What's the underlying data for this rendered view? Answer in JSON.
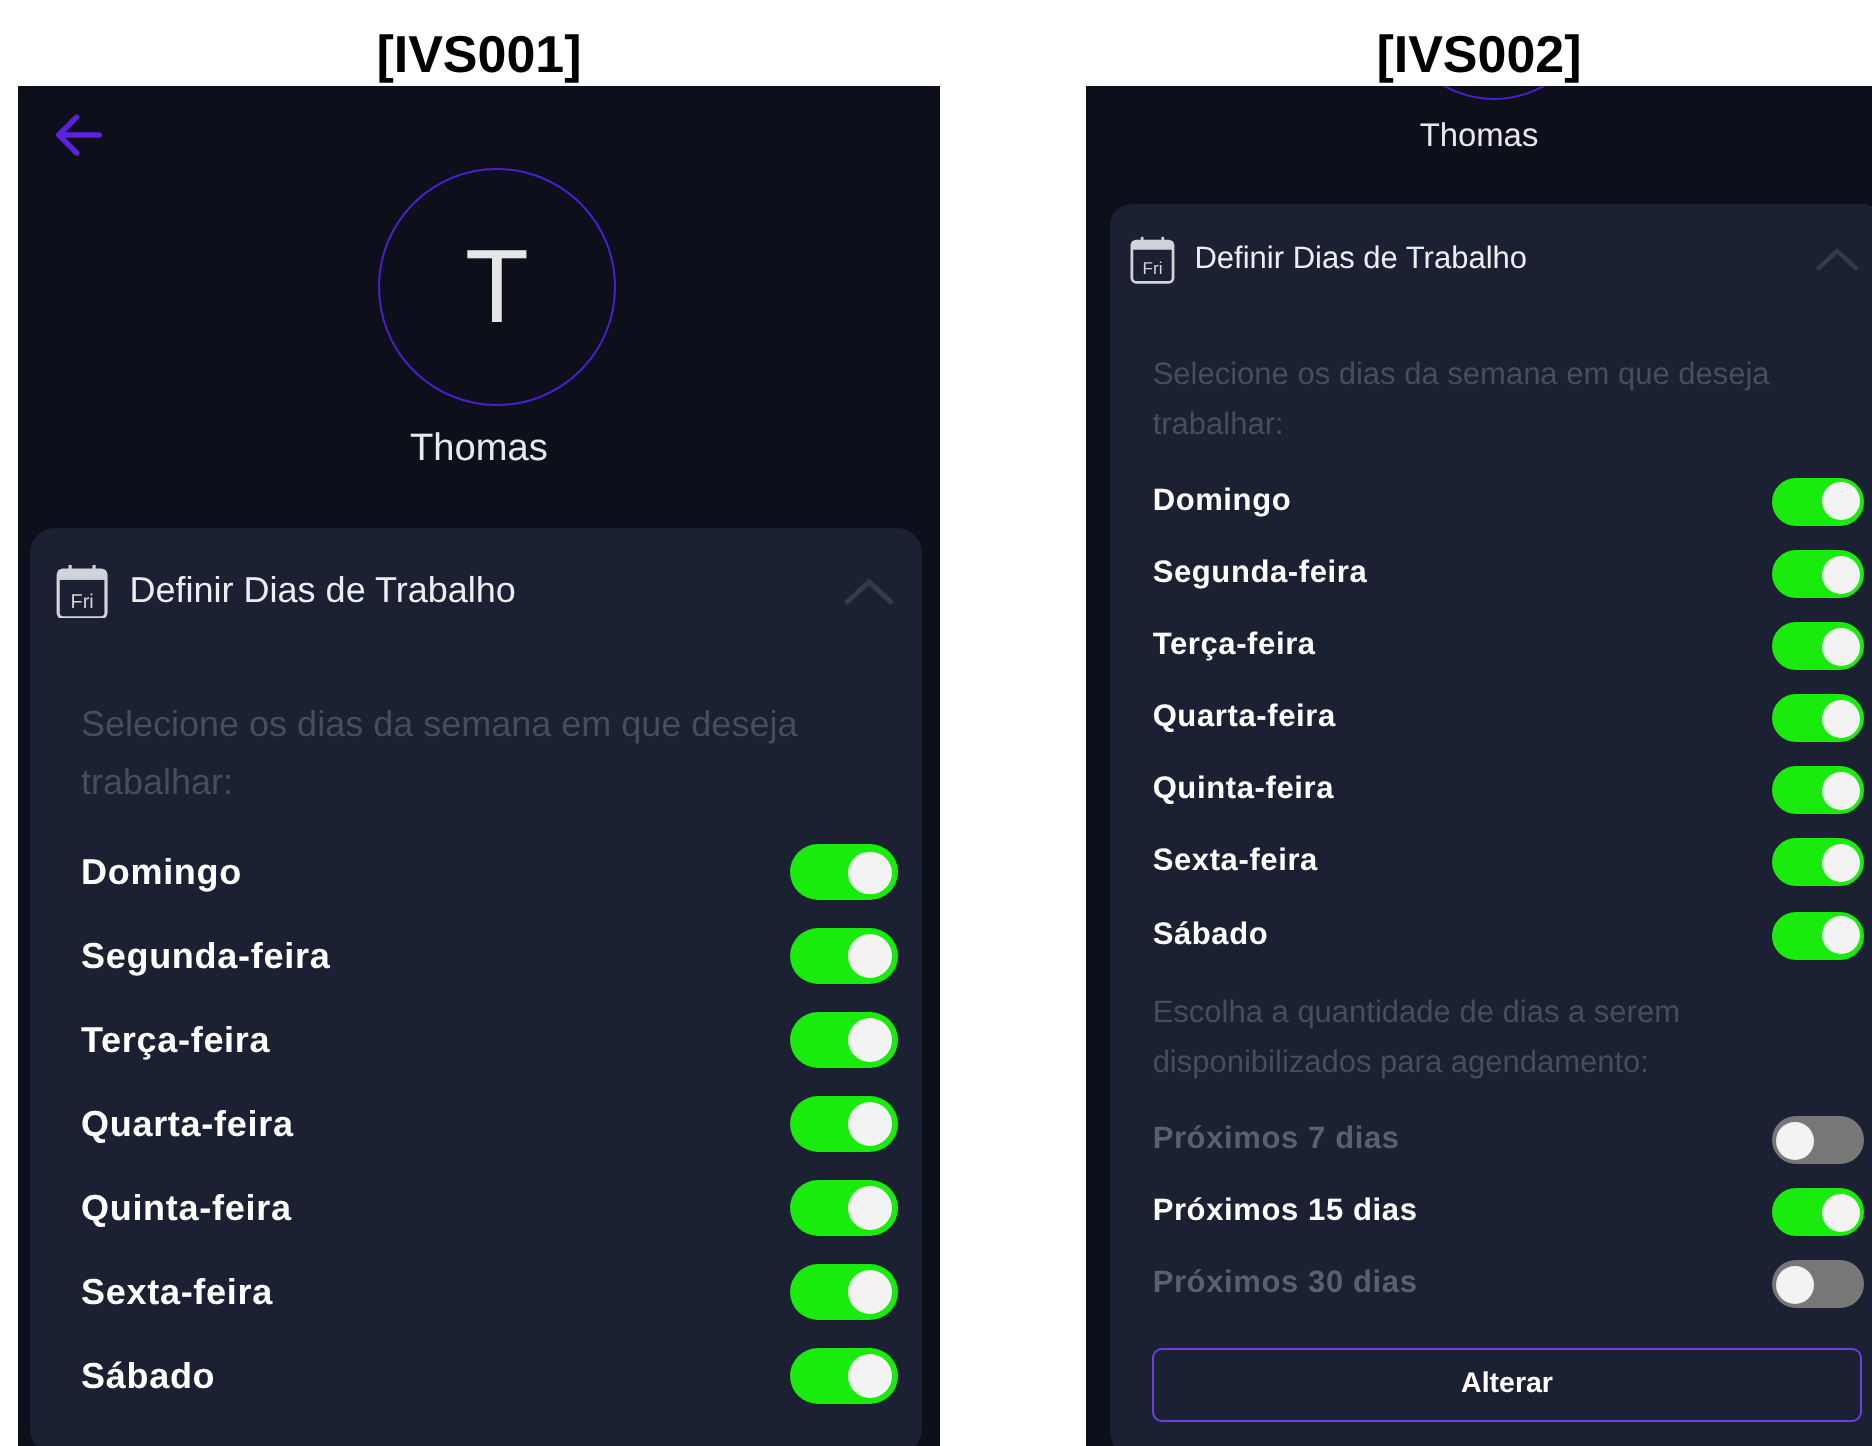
{
  "screens": [
    {
      "label": "[IVS001]",
      "kind": "top",
      "back_button": true,
      "avatar": {
        "initial": "T"
      },
      "name": "Thomas",
      "card": {
        "title": "Definir Dias de Trabalho",
        "icon_label": "Fri",
        "expanded": true,
        "sections": [
          {
            "description": "Selecione os dias da semana em que deseja trabalhar:",
            "options": [
              {
                "label": "Domingo",
                "on": true
              },
              {
                "label": "Segunda-feira",
                "on": true
              },
              {
                "label": "Terça-feira",
                "on": true
              },
              {
                "label": "Quarta-feira",
                "on": true
              },
              {
                "label": "Quinta-feira",
                "on": true
              },
              {
                "label": "Sexta-feira",
                "on": true
              },
              {
                "label": "Sábado",
                "on": true
              }
            ]
          }
        ]
      }
    },
    {
      "label": "[IVS002]",
      "kind": "scrolled",
      "name": "Thomas",
      "card": {
        "title": "Definir Dias de Trabalho",
        "icon_label": "Fri",
        "expanded": true,
        "sections": [
          {
            "description": "Selecione os dias da semana em que deseja trabalhar:",
            "options": [
              {
                "label": "Domingo",
                "on": true
              },
              {
                "label": "Segunda-feira",
                "on": true
              },
              {
                "label": "Terça-feira",
                "on": true
              },
              {
                "label": "Quarta-feira",
                "on": true
              },
              {
                "label": "Quinta-feira",
                "on": true
              },
              {
                "label": "Sexta-feira",
                "on": true
              },
              {
                "label": "Sábado",
                "on": true
              }
            ]
          },
          {
            "description": "Escolha a quantidade de dias a serem disponibilizados para agendamento:",
            "options": [
              {
                "label": "Próximos 7 dias",
                "on": false
              },
              {
                "label": "Próximos 15 dias",
                "on": true
              },
              {
                "label": "Próximos 30 dias",
                "on": false
              }
            ]
          }
        ],
        "button": "Alterar"
      }
    }
  ]
}
